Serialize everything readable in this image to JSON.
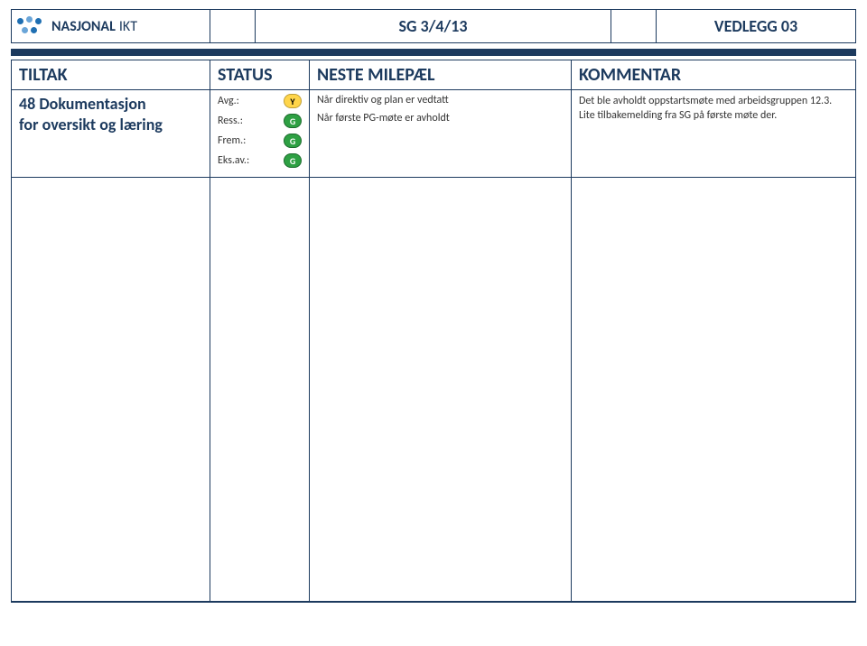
{
  "header": {
    "logo_main": "NASJONAL",
    "logo_sub": "IKT",
    "center": "SG 3/4/13",
    "right": "VEDLEGG 03"
  },
  "table": {
    "headers": {
      "col1": "TILTAK",
      "col2": "STATUS",
      "col3": "NESTE MILEPÆL",
      "col4": "KOMMENTAR"
    },
    "row": {
      "tiltak_line1": "48 Dokumentasjon",
      "tiltak_line2": "for oversikt og læring",
      "status": [
        {
          "label": "Avg.:",
          "code": "Y"
        },
        {
          "label": "Ress.:",
          "code": "G"
        },
        {
          "label": "Frem.:",
          "code": "G"
        },
        {
          "label": "Eks.av.:",
          "code": "G"
        }
      ],
      "milepael": [
        "Når direktiv og plan er vedtatt",
        "Når første PG-møte er avholdt"
      ],
      "kommentar": "Det ble avholdt oppstartsmøte med arbeidsgruppen 12.3. Lite tilbakemelding fra SG på første møte der."
    }
  }
}
